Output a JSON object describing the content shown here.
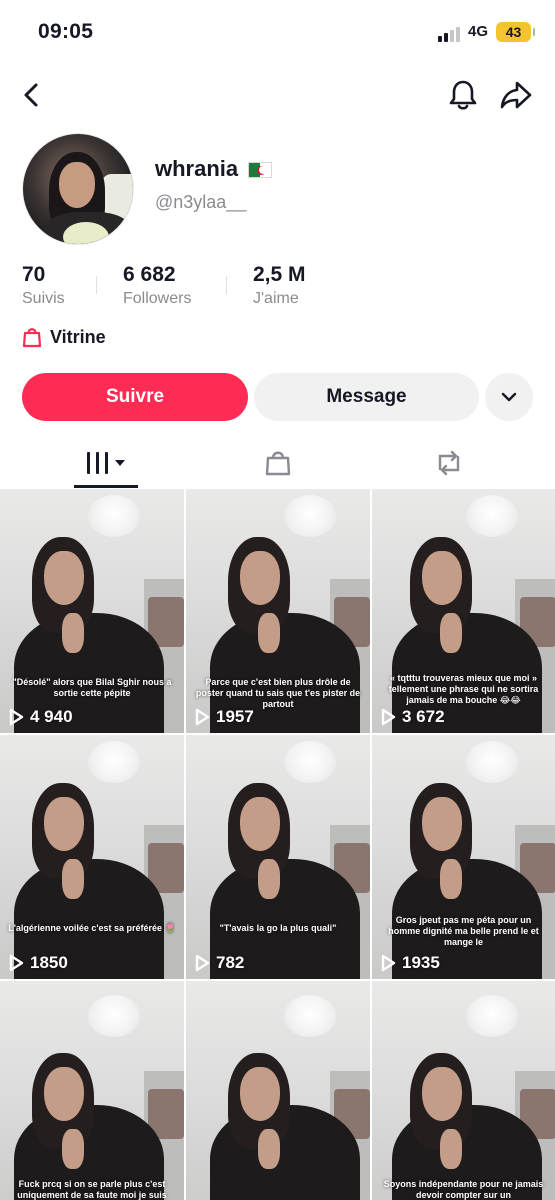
{
  "status_bar": {
    "time": "09:05",
    "network": "4G",
    "battery": "43",
    "battery_color": "#f4c430"
  },
  "nav": {
    "back_icon": "chevron-left-icon",
    "bell_icon": "bell-icon",
    "share_icon": "share-arrow-icon"
  },
  "profile": {
    "display_name": "whrania",
    "flag_icon": "algeria-flag-icon",
    "username": "@n3ylaa__",
    "stats": [
      {
        "value": "70",
        "label": "Suivis"
      },
      {
        "value": "6 682",
        "label": "Followers"
      },
      {
        "value": "2,5 M",
        "label": "J'aime"
      }
    ],
    "vitrine_label": "Vitrine",
    "vitrine_icon": "shopping-bag-icon"
  },
  "actions": {
    "follow_label": "Suivre",
    "message_label": "Message",
    "more_icon": "chevron-down-icon",
    "follow_color": "#fe2c55"
  },
  "tabs": [
    {
      "icon": "grid-columns-icon",
      "active": true
    },
    {
      "icon": "shopping-bag-icon",
      "active": false
    },
    {
      "icon": "repost-icon",
      "active": false
    }
  ],
  "videos": [
    {
      "caption": "\"Désolé\" alors que Bilal Sghir nous a sortie cette pépite",
      "plays": "4 940"
    },
    {
      "caption": "Parce que c'est bien plus drôle de poster quand tu sais que t'es pister de partout",
      "plays": "1957"
    },
    {
      "caption": "« tqtttu trouveras mieux que moi » tellement une phrase qui ne sortira jamais de ma bouche 😂😂",
      "plays": "3 672"
    },
    {
      "caption": "L'algérienne voilée c'est sa préférée 🌷",
      "plays": "1850"
    },
    {
      "caption": "\"T'avais la go la plus quali\"",
      "plays": "782"
    },
    {
      "caption": "Gros jpeut pas me péta pour un homme dignité ma belle prend le et mange le",
      "plays": "1935"
    },
    {
      "caption": "Fuck prcq si on se parle plus c'est uniquement de sa faute moi je suis trop parfaite",
      "plays": ""
    },
    {
      "caption": "",
      "plays": ""
    },
    {
      "caption": "Soyons indépendante pour ne jamais devoir compter sur un",
      "plays": ""
    }
  ]
}
